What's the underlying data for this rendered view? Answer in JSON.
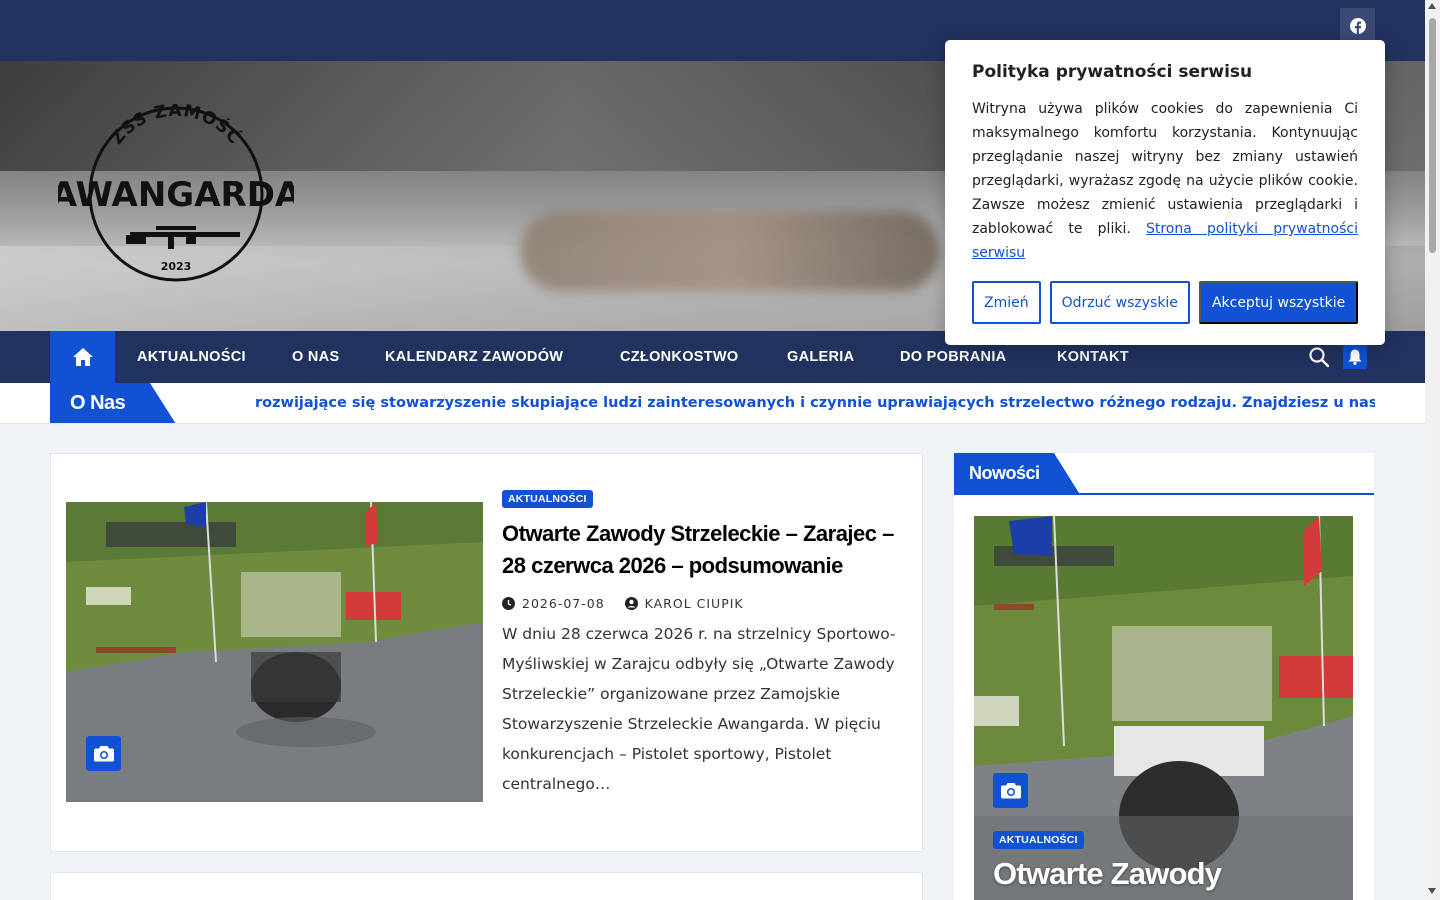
{
  "site": {
    "logo_text_top": "ZSS ZAMOŚĆ",
    "logo_text_main": "AWANGARDA",
    "logo_year": "2023"
  },
  "topbar": {
    "social_icon": "facebook-icon"
  },
  "nav": {
    "home_icon": "home-icon",
    "items": [
      "AKTUALNOŚCI",
      "O NAS",
      "KALENDARZ ZAWODÓW",
      "CZŁONKOSTWO",
      "GALERIA",
      "DO POBRANIA",
      "KONTAKT"
    ],
    "search_icon": "search-icon",
    "bell_icon": "bell-icon"
  },
  "ticker": {
    "label": "O Nas",
    "text": "rozwijające się stowarzyszenie skupiające ludzi zainteresowanych i czynnie uprawiających strzelectwo różnego rodzaju. Znajdziesz u nas wiel"
  },
  "post": {
    "category": "AKTUALNOŚCI",
    "title": "Otwarte Zawody Strzeleckie – Zarajec – 28 czerwca 2026 – podsumowanie",
    "date": "2026-07-08",
    "author": "KAROL CIUPIK",
    "excerpt": "W dniu 28 czerwca 2026 r. na strzelnicy Sportowo-Myśliwskiej w Zarajcu odbyły się „Otwarte Zawody Strzeleckie” organizowane przez Zamojskie Stowarzyszenie Strzeleckie Awangarda. W pięciu konkurencjach – Pistolet sportowy, Pistolet centralnego…"
  },
  "sidebar": {
    "title": "Nowości",
    "post_category": "AKTUALNOŚCI",
    "post_title": "Otwarte Zawody"
  },
  "cookie": {
    "title": "Polityka prywatności serwisu",
    "body": "Witryna używa plików cookies do zapewnienia Ci maksymalnego komfortu korzystania. Kontynuując przeglądanie naszej witryny bez zmiany ustawień przeglądarki, wyrażasz zgodę na użycie plików cookie. Zawsze możesz zmienić ustawienia przeglądarki i zablokować te pliki.",
    "link": "Strona polityki prywatności serwisu",
    "btn_change": "Zmień",
    "btn_reject": "Odrzuć wszyskie",
    "btn_accept": "Akceptuj wszystkie"
  },
  "colors": {
    "navy": "#22325f",
    "accent": "#1151d3"
  }
}
